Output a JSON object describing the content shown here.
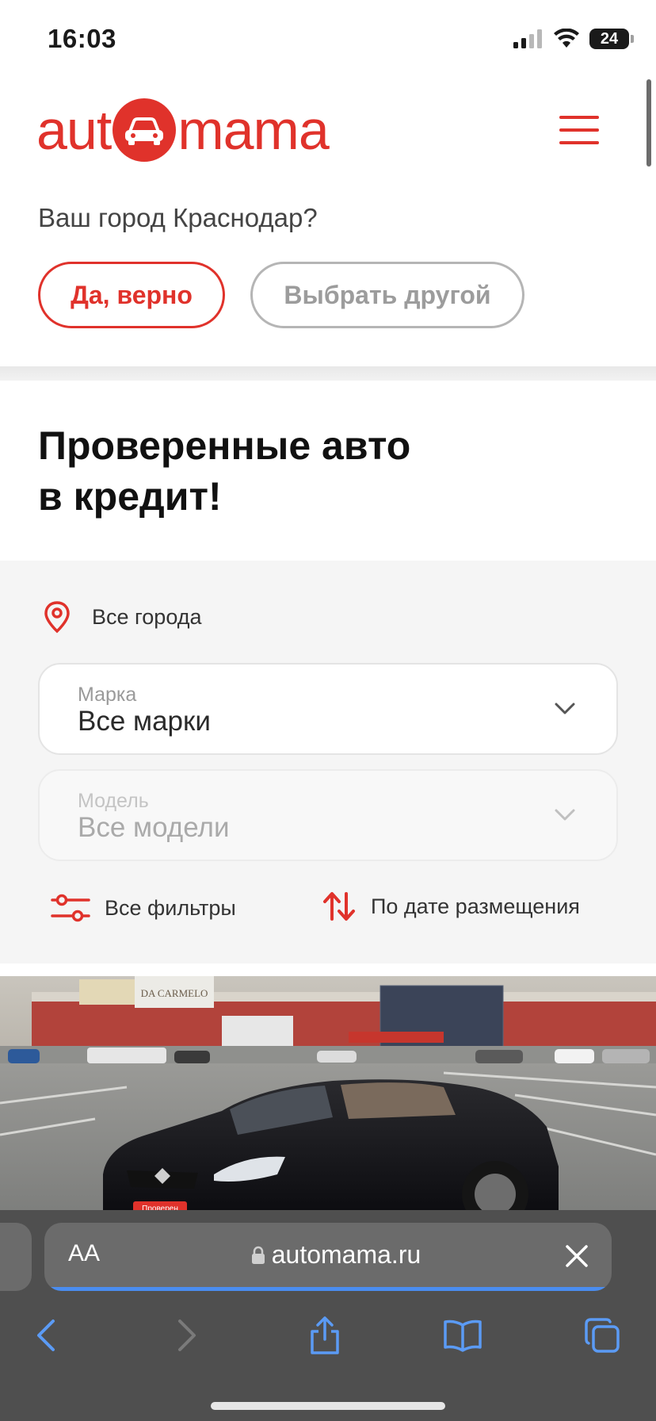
{
  "status_bar": {
    "time": "16:03",
    "battery": "24"
  },
  "header": {
    "logo_part1": "aut",
    "logo_part2": "mama"
  },
  "city_prompt": {
    "question": "Ваш город Краснодар?",
    "confirm_label": "Да, верно",
    "choose_other_label": "Выбрать другой"
  },
  "hero": {
    "title_line1": "Проверенные авто",
    "title_line2": "в кредит!"
  },
  "filters": {
    "city_label": "Все города",
    "brand": {
      "label": "Марка",
      "value": "Все марки"
    },
    "model": {
      "label": "Модель",
      "value": "Все модели"
    },
    "all_filters_label": "Все фильтры",
    "sort_label": "По дате размещения"
  },
  "listing": {
    "sign_text": "DA CARMELO",
    "badge_text": "Проверен"
  },
  "browser": {
    "text_size_label": "AA",
    "url": "automama.ru"
  },
  "colors": {
    "brand_red": "#e0322b",
    "chrome_bg": "#4f4f4f",
    "progress_blue": "#4a8df0"
  }
}
